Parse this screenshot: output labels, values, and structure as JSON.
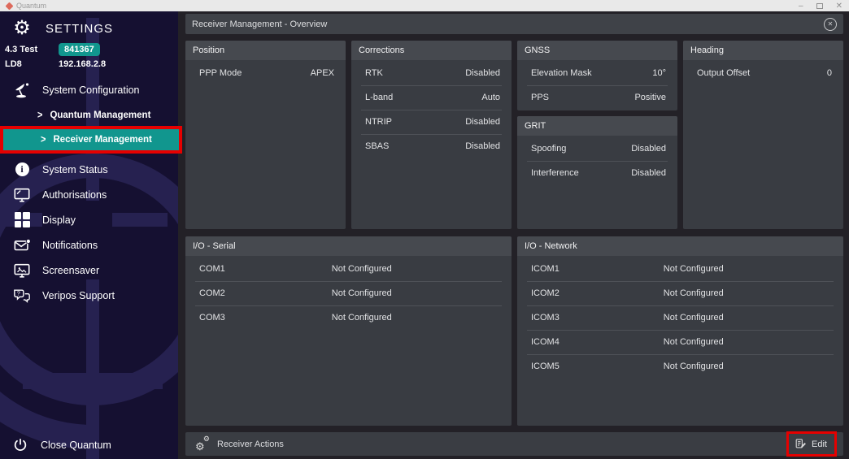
{
  "window": {
    "app_name": "Quantum",
    "controls": {
      "minimize_glyph": "–",
      "close_glyph": "✕"
    }
  },
  "icons": {
    "gear": "⚙",
    "chevron": ">",
    "close": "✕",
    "info": "i"
  },
  "sidebar": {
    "title": "SETTINGS",
    "version": "4.3 Test",
    "badge": "841367",
    "device": "LD8",
    "ip": "192.168.2.8",
    "section": {
      "label": "System Configuration",
      "subitems": [
        {
          "label": "Quantum Management"
        },
        {
          "label": "Receiver Management"
        }
      ]
    },
    "items": [
      {
        "label": "System Status"
      },
      {
        "label": "Authorisations"
      },
      {
        "label": "Display"
      },
      {
        "label": "Notifications"
      },
      {
        "label": "Screensaver"
      },
      {
        "label": "Veripos Support"
      }
    ],
    "close_label": "Close Quantum"
  },
  "main": {
    "header_title": "Receiver Management - Overview",
    "cards": {
      "position": {
        "title": "Position",
        "rows": [
          {
            "label": "PPP Mode",
            "value": "APEX"
          }
        ]
      },
      "corrections": {
        "title": "Corrections",
        "rows": [
          {
            "label": "RTK",
            "value": "Disabled"
          },
          {
            "label": "L-band",
            "value": "Auto"
          },
          {
            "label": "NTRIP",
            "value": "Disabled"
          },
          {
            "label": "SBAS",
            "value": "Disabled"
          }
        ]
      },
      "gnss": {
        "title": "GNSS",
        "rows": [
          {
            "label": "Elevation Mask",
            "value": "10°"
          },
          {
            "label": "PPS",
            "value": "Positive"
          }
        ]
      },
      "grit": {
        "title": "GRIT",
        "rows": [
          {
            "label": "Spoofing",
            "value": "Disabled"
          },
          {
            "label": "Interference",
            "value": "Disabled"
          }
        ]
      },
      "heading": {
        "title": "Heading",
        "rows": [
          {
            "label": "Output Offset",
            "value": "0"
          }
        ]
      },
      "io_serial": {
        "title": "I/O - Serial",
        "rows": [
          {
            "label": "COM1",
            "value": "Not Configured"
          },
          {
            "label": "COM2",
            "value": "Not Configured"
          },
          {
            "label": "COM3",
            "value": "Not Configured"
          }
        ]
      },
      "io_network": {
        "title": "I/O - Network",
        "rows": [
          {
            "label": "ICOM1",
            "value": "Not Configured"
          },
          {
            "label": "ICOM2",
            "value": "Not Configured"
          },
          {
            "label": "ICOM3",
            "value": "Not Configured"
          },
          {
            "label": "ICOM4",
            "value": "Not Configured"
          },
          {
            "label": "ICOM5",
            "value": "Not Configured"
          }
        ]
      }
    },
    "footer": {
      "actions_label": "Receiver Actions",
      "edit_label": "Edit"
    }
  },
  "colors": {
    "accent_teal": "#11968E",
    "annotation_red": "#E60000",
    "sidebar_bg": "#151031",
    "card_bg": "#393C42",
    "card_header_bg": "#46494F"
  }
}
